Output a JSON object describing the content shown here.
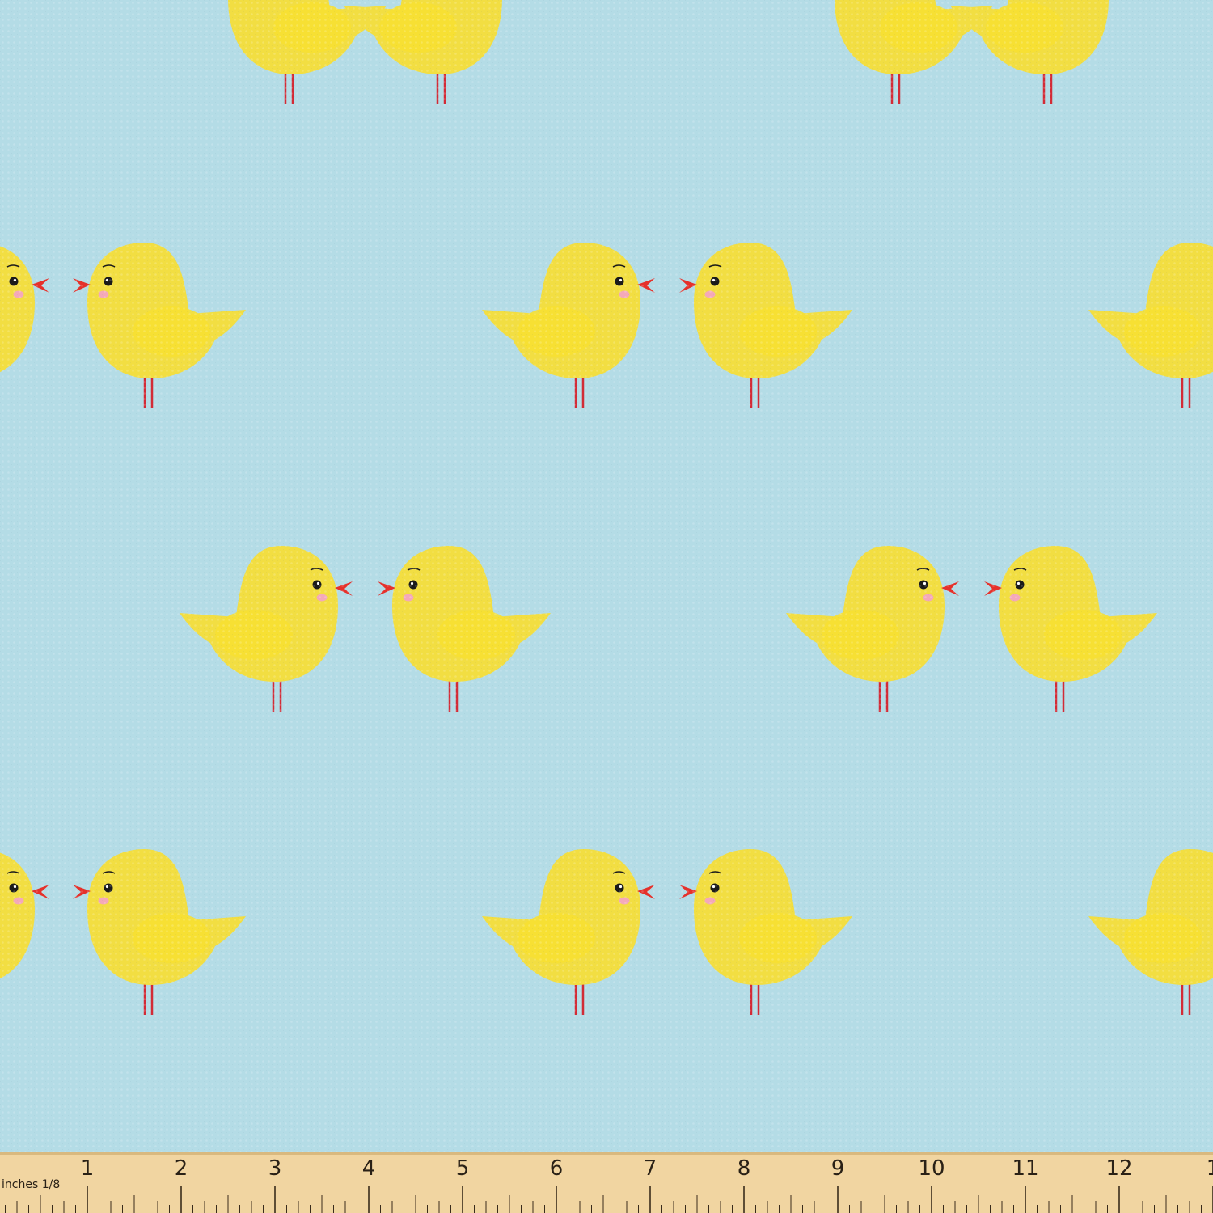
{
  "image": {
    "background_color": "#b4dce6",
    "chick_body_color": "#f2de42",
    "chick_wing_color": "#f7e032",
    "beak_color": "#e5312b",
    "leg_color": "#d22b36",
    "cheek_color": "#f4a9b9",
    "eye_color": "#1a1a1a"
  },
  "ruler": {
    "unit_label": "inches 1/8",
    "numbers": [
      "1",
      "2",
      "3",
      "4",
      "5",
      "6",
      "7",
      "8",
      "9",
      "10",
      "11",
      "12",
      "1"
    ],
    "wood_color": "#f1d5a1",
    "tick_color": "#3a2c1c"
  }
}
